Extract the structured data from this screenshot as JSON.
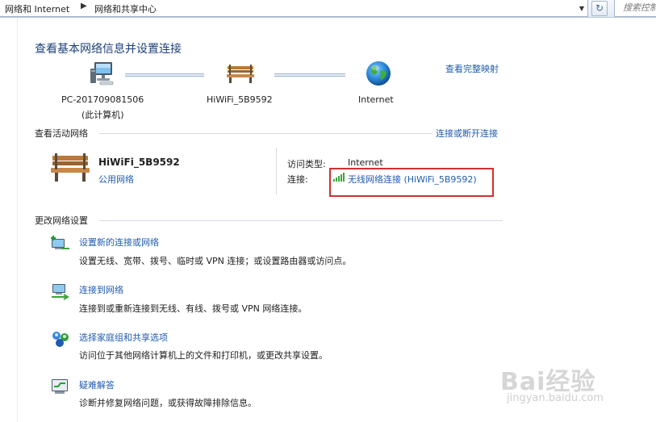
{
  "address_bar": {
    "crumbs": [
      "网络和 Internet",
      "网络和共享中心"
    ],
    "separator": "▶",
    "dropdown_glyph": "▼",
    "refresh_glyph": "↻",
    "search_placeholder": "搜索控制"
  },
  "page": {
    "title": "查看基本网络信息并设置连接",
    "view_full_map": "查看完整映射"
  },
  "network_map": {
    "nodes": [
      {
        "icon": "computer-icon",
        "label_line1": "PC-201709081506",
        "label_line2": "(此计算机)"
      },
      {
        "icon": "bench-icon",
        "label_line1": "HiWiFi_5B9592"
      },
      {
        "icon": "globe-icon",
        "label_line1": "Internet"
      }
    ]
  },
  "active_networks": {
    "heading": "查看活动网络",
    "connect_disconnect": "连接或断开连接",
    "network_name": "HiWiFi_5B9592",
    "network_type": "公用网络",
    "access_type_label": "访问类型:",
    "access_type_value": "Internet",
    "connection_label": "连接:",
    "connection_value": "无线网络连接 (HiWiFi_5B9592)",
    "highlight_color": "#d32f2f"
  },
  "change_settings": {
    "heading": "更改网络设置",
    "tasks": [
      {
        "icon": "new-connection-icon",
        "title": "设置新的连接或网络",
        "desc": "设置无线、宽带、拨号、临时或 VPN 连接；或设置路由器或访问点。"
      },
      {
        "icon": "connect-network-icon",
        "title": "连接到网络",
        "desc": "连接到或重新连接到无线、有线、拨号或 VPN 网络连接。"
      },
      {
        "icon": "homegroup-icon",
        "title": "选择家庭组和共享选项",
        "desc": "访问位于其他网络计算机上的文件和打印机，或更改共享设置。"
      },
      {
        "icon": "troubleshoot-icon",
        "title": "疑难解答",
        "desc": "诊断并修复网络问题，或获得故障排除信息。"
      }
    ]
  },
  "watermark": {
    "brand": "Bai经验",
    "site": "jingyan.baidu.com"
  },
  "colors": {
    "link": "#1f5bb0",
    "title": "#1e3f78"
  }
}
